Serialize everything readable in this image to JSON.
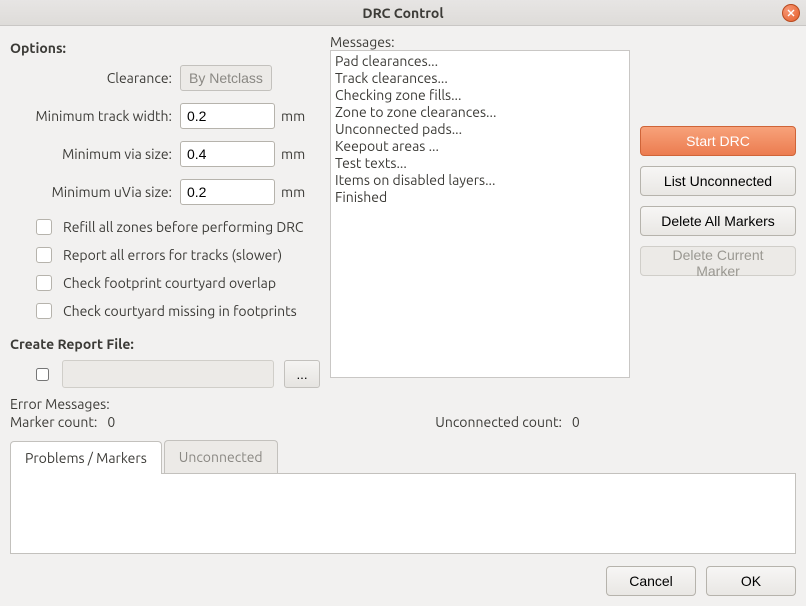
{
  "title": "DRC Control",
  "options": {
    "header": "Options:",
    "clearance_label": "Clearance:",
    "clearance_button": "By Netclass",
    "min_track_label": "Minimum track width:",
    "min_track_value": "0.2",
    "min_via_label": "Minimum via size:",
    "min_via_value": "0.4",
    "min_uvia_label": "Minimum uVia size:",
    "min_uvia_value": "0.2",
    "unit": "mm",
    "check_refill": "Refill all zones before performing DRC",
    "check_report_all": "Report all errors for tracks (slower)",
    "check_courtyard_overlap": "Check footprint courtyard overlap",
    "check_courtyard_missing": "Check courtyard missing in footprints"
  },
  "report": {
    "header": "Create Report File:",
    "path": "",
    "browse": "..."
  },
  "messages": {
    "header": "Messages:",
    "lines": "Pad clearances...\nTrack clearances...\nChecking zone fills...\nZone to zone clearances...\nUnconnected pads...\nKeepout areas ...\nTest texts...\nItems on disabled layers...\nFinished"
  },
  "actions": {
    "start": "Start DRC",
    "list_unconnected": "List Unconnected",
    "delete_all": "Delete All Markers",
    "delete_current": "Delete Current Marker"
  },
  "errors": {
    "header": "Error Messages:",
    "marker_label": "Marker count:",
    "marker_value": "0",
    "unconnected_label": "Unconnected count:",
    "unconnected_value": "0"
  },
  "tabs": {
    "problems": "Problems / Markers",
    "unconnected": "Unconnected"
  },
  "footer": {
    "cancel": "Cancel",
    "ok": "OK"
  }
}
